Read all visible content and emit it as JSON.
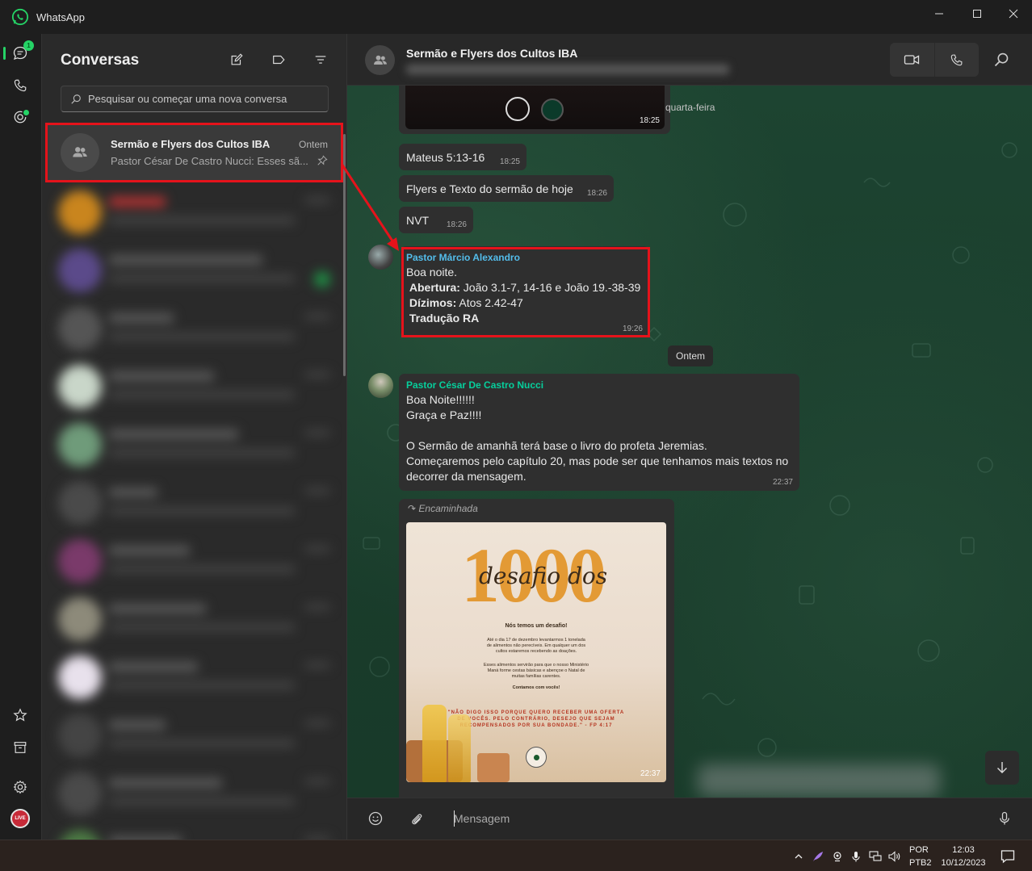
{
  "window": {
    "title": "WhatsApp"
  },
  "rail": {
    "chats_badge": "1",
    "me_avatar_text": "LIVE"
  },
  "sidebar": {
    "heading": "Conversas",
    "search_placeholder": "Pesquisar ou começar uma nova conversa",
    "selected_chat": {
      "name": "Sermão e Flyers dos Cultos IBA",
      "time": "Ontem",
      "preview": "Pastor César De Castro Nucci: Esses sã..."
    }
  },
  "chat": {
    "header": {
      "name": "Sermão e Flyers dos Cultos IBA"
    },
    "top_image": {
      "time": "18:25"
    },
    "day_label_1": "quarta-feira",
    "messages_1": [
      {
        "text": "Mateus 5:13-16",
        "time": "18:25"
      },
      {
        "text": "Flyers e Texto do sermão de hoje",
        "time": "18:26"
      },
      {
        "text": "NVT",
        "time": "18:26"
      }
    ],
    "marcio": {
      "sender": "Pastor Márcio Alexandro",
      "greeting": "Boa noite.",
      "abertura_label": "Abertura:",
      "abertura_text": " João 3.1-7, 14-16 e João 19.-38-39",
      "dizimos_label": "Dízimos:",
      "dizimos_text": " Atos 2.42-47",
      "traducao": "Tradução RA",
      "time": "19:26"
    },
    "day_chip": "Ontem",
    "cesar": {
      "sender": "Pastor César De Castro Nucci",
      "lines": [
        "Boa Noite!!!!!!",
        "Graça e Paz!!!!",
        "",
        "O Sermão de amanhã terá base o livro do profeta Jeremias.",
        "Começaremos pelo capítulo 20, mas pode ser que tenhamos mais textos no",
        "decorrer da mensagem."
      ],
      "time": "22:37"
    },
    "forwarded": {
      "label": "Encaminhada",
      "time": "22:37",
      "poster": {
        "big": "1000",
        "script": "desafio dos",
        "subtitle": "Nós temos um desafio!",
        "para1": [
          "Até o dia 17 de dezembro levantarmos 1 tonelada",
          "de alimentos não perecíveis. Em qualquer um dos",
          "cultos estaremos recebendo as doações."
        ],
        "para2": [
          "Esses alimentos servirão para que o nosso Ministério",
          "Maná forme cestas básicas e abençoe o Natal de",
          "muitas famílias carentes."
        ],
        "para3": "Contamos com vocês!",
        "quote": "\"NÃO DIGO ISSO PORQUE QUERO RECEBER UMA OFERTA DE VOCÊS. PELO CONTRÁRIO, DESEJO QUE SEJAM RECOMPENSADOS POR SUA BONDADE.\" - FP 4:17"
      }
    },
    "composer_placeholder": "Mensagem"
  },
  "taskbar": {
    "lang_1": "POR",
    "lang_2": "PTB2",
    "time": "12:03",
    "date": "10/12/2023"
  },
  "colors": {
    "accent": "#25d366",
    "marcio_sender": "#53bdeb",
    "cesar_sender": "#06cf9c",
    "annotation_red": "#e5131b"
  }
}
